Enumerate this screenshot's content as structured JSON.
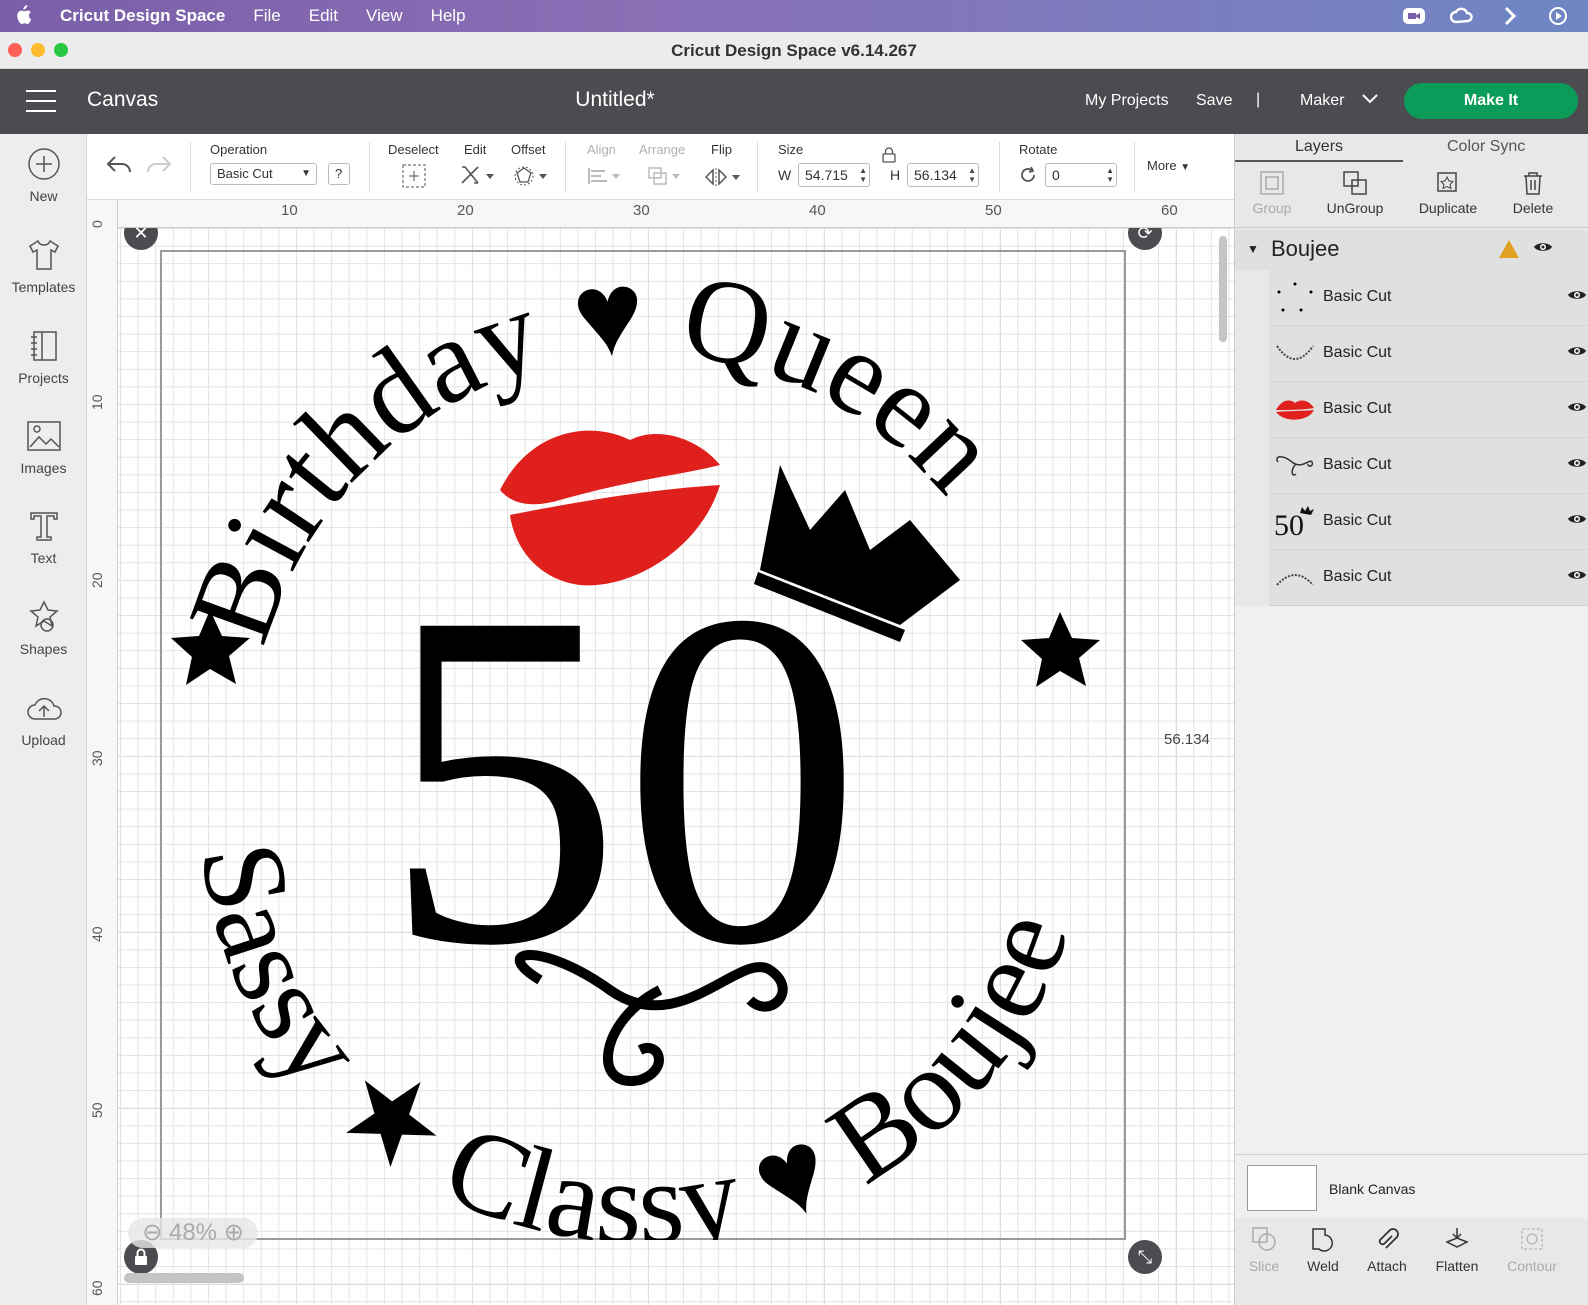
{
  "menubar": {
    "app_name": "Cricut Design Space",
    "items": [
      "File",
      "Edit",
      "View",
      "Help"
    ]
  },
  "window": {
    "title": "Cricut Design Space  v6.14.267"
  },
  "header": {
    "section": "Canvas",
    "document_title": "Untitled*",
    "my_projects": "My Projects",
    "save": "Save",
    "separator": "|",
    "machine": "Maker",
    "make_it": "Make It",
    "accent_color": "#0c9c5a"
  },
  "sidebar": {
    "items": [
      {
        "label": "New",
        "icon": "plus-circle-icon"
      },
      {
        "label": "Templates",
        "icon": "tshirt-icon"
      },
      {
        "label": "Projects",
        "icon": "notebook-icon"
      },
      {
        "label": "Images",
        "icon": "image-icon"
      },
      {
        "label": "Text",
        "icon": "text-icon"
      },
      {
        "label": "Shapes",
        "icon": "shapes-icon"
      },
      {
        "label": "Upload",
        "icon": "cloud-upload-icon"
      }
    ]
  },
  "toolbar": {
    "operation_label": "Operation",
    "operation_value": "Basic Cut",
    "help": "?",
    "deselect": "Deselect",
    "edit": "Edit",
    "offset": "Offset",
    "align": "Align",
    "arrange": "Arrange",
    "flip": "Flip",
    "size_label": "Size",
    "w_label": "W",
    "w_value": "54.715",
    "h_label": "H",
    "h_value": "56.134",
    "rotate_label": "Rotate",
    "rotate_value": "0",
    "more": "More"
  },
  "ruler": {
    "h_ticks": [
      "10",
      "20",
      "30",
      "40",
      "50",
      "60"
    ],
    "v_ticks": [
      "0",
      "10",
      "20",
      "30",
      "40",
      "50",
      "60"
    ]
  },
  "canvas": {
    "height_readout": "56.134",
    "zoom": "48%",
    "design": {
      "top_arc": "Birthday",
      "top_arc_2": "Queen",
      "bottom_left": "Sassy",
      "bottom_mid": "Classy",
      "bottom_right": "Boujee",
      "number": "50",
      "lips_color": "#e0201c"
    }
  },
  "panel": {
    "tabs": [
      "Layers",
      "Color Sync"
    ],
    "tools": [
      "Group",
      "UnGroup",
      "Duplicate",
      "Delete"
    ],
    "group_name": "Boujee",
    "layers": [
      {
        "name": "Basic Cut",
        "thumb": "dots"
      },
      {
        "name": "Basic Cut",
        "thumb": "text-arc-small"
      },
      {
        "name": "Basic Cut",
        "thumb": "lips"
      },
      {
        "name": "Basic Cut",
        "thumb": "flourish"
      },
      {
        "name": "Basic Cut",
        "thumb": "50-crown"
      },
      {
        "name": "Basic Cut",
        "thumb": "text-arc"
      }
    ],
    "blank_canvas": "Blank Canvas",
    "bottom_tools": [
      "Slice",
      "Weld",
      "Attach",
      "Flatten",
      "Contour"
    ]
  }
}
